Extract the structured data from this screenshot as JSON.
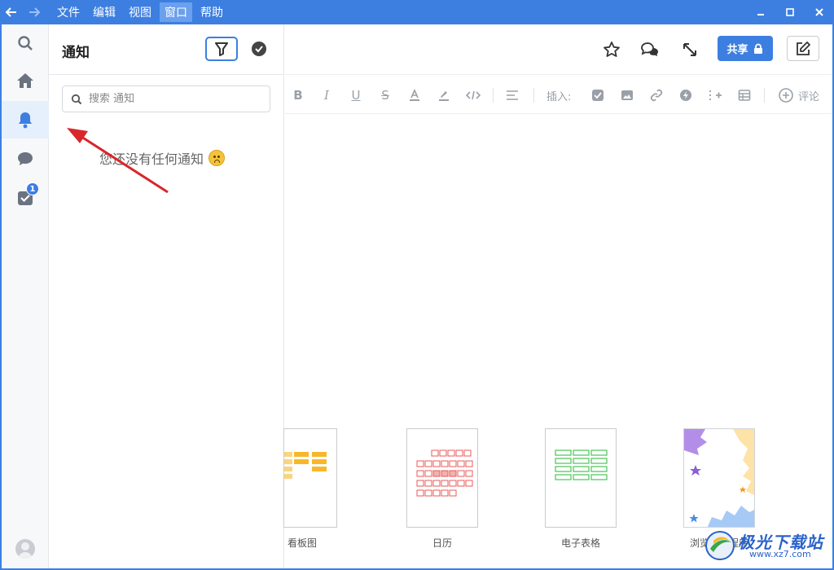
{
  "titlebar": {
    "back_icon": "arrow-left-icon",
    "forward_icon": "arrow-right-icon",
    "menu": [
      "文件",
      "编辑",
      "视图",
      "窗口",
      "帮助"
    ],
    "active_menu": "窗口"
  },
  "panel": {
    "title": "通知",
    "search_placeholder": "搜索 通知",
    "empty_text": "您还没有任何通知"
  },
  "rail": {
    "badge_count": "1"
  },
  "main": {
    "share_label": "共享",
    "toolbar_insert_label": "插入:",
    "toolbar_comment_label": "评论"
  },
  "templates": [
    {
      "label": "看板图"
    },
    {
      "label": "日历"
    },
    {
      "label": "电子表格"
    },
    {
      "label": "浏览应用程序"
    }
  ],
  "watermark": {
    "text": "极光下载站",
    "url": "www.xz7.com"
  },
  "colors": {
    "accent": "#3d7fe0",
    "kanban": "#f8b72a",
    "calendar": "#e85858",
    "spreadsheet": "#49c456",
    "annotation_arrow": "#d9262b"
  }
}
